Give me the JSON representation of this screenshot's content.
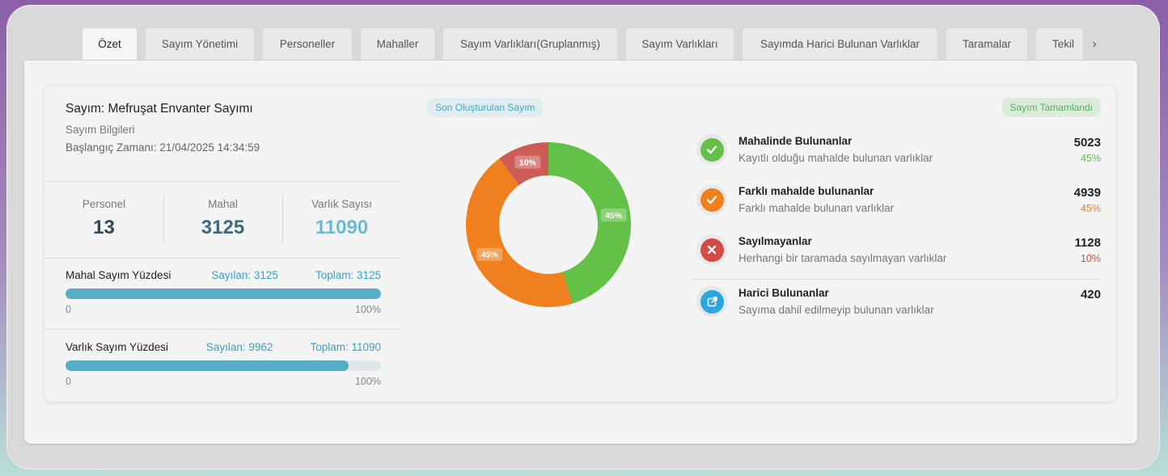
{
  "tabs": [
    "Özet",
    "Sayım Yönetimi",
    "Personeller",
    "Mahaller",
    "Sayım Varlıkları(Gruplanmış)",
    "Sayım Varlıkları",
    "Sayımda Harici Bulunan Varlıklar",
    "Taramalar",
    "Tekil"
  ],
  "active_tab": "Özet",
  "tab_next_label": "›",
  "summary": {
    "title": "Sayım: Mefruşat Envanter Sayımı",
    "subtitle": "Sayım Bilgileri",
    "start_time": "Başlangıç Zamanı: 21/04/2025 14:34:59"
  },
  "stats": [
    {
      "label": "Personel",
      "value": "13",
      "color": "#2f4a54"
    },
    {
      "label": "Mahal",
      "value": "3125",
      "color": "#3f6a77"
    },
    {
      "label": "Varlık Sayısı",
      "value": "11090",
      "color": "#6cbad1"
    }
  ],
  "progress": [
    {
      "title": "Mahal Sayım Yüzdesi",
      "counted": "Sayılan: 3125",
      "total": "Toplam: 3125",
      "fraction": 1.0,
      "min": "0",
      "max": "100%"
    },
    {
      "title": "Varlık Sayım Yüzdesi",
      "counted": "Sayılan: 9962",
      "total": "Toplam: 11090",
      "fraction": 0.898,
      "min": "0",
      "max": "100%"
    }
  ],
  "badges": {
    "last_created": "Son Oluşturulan Sayım",
    "completed": "Sayım Tamamlandı"
  },
  "chart_data": {
    "type": "pie",
    "categories": [
      "Mahalinde Bulunanlar",
      "Farklı mahalde bulunanlar",
      "Sayılmayanlar"
    ],
    "values": [
      5023,
      4939,
      1128
    ],
    "labels": [
      "45%",
      "45%",
      "10%"
    ],
    "colors": [
      "#62c146",
      "#f0801e",
      "#cd5c56"
    ]
  },
  "legend": [
    {
      "title": "Mahalinde Bulunanlar",
      "desc": "Kayıtlı olduğu mahalde bulunan varlıklar",
      "value": "5023",
      "pct": "45%",
      "color": "#62c146",
      "icon": "check-circle-icon"
    },
    {
      "title": "Farklı mahalde bulunanlar",
      "desc": "Farklı mahalde bulunan varlıklar",
      "value": "4939",
      "pct": "45%",
      "color": "#f0801e",
      "icon": "check-circle-orange-icon"
    },
    {
      "title": "Sayılmayanlar",
      "desc": "Herhangi bir taramada sayılmayan varlıklar",
      "value": "1128",
      "pct": "10%",
      "color": "#d44a44",
      "icon": "x-circle-icon"
    },
    {
      "title": "Harici Bulunanlar",
      "desc": "Sayıma dahil edilmeyip bulunan varlıklar",
      "value": "420",
      "pct": "",
      "color": "#2ba6e0",
      "icon": "external-link-icon"
    }
  ]
}
